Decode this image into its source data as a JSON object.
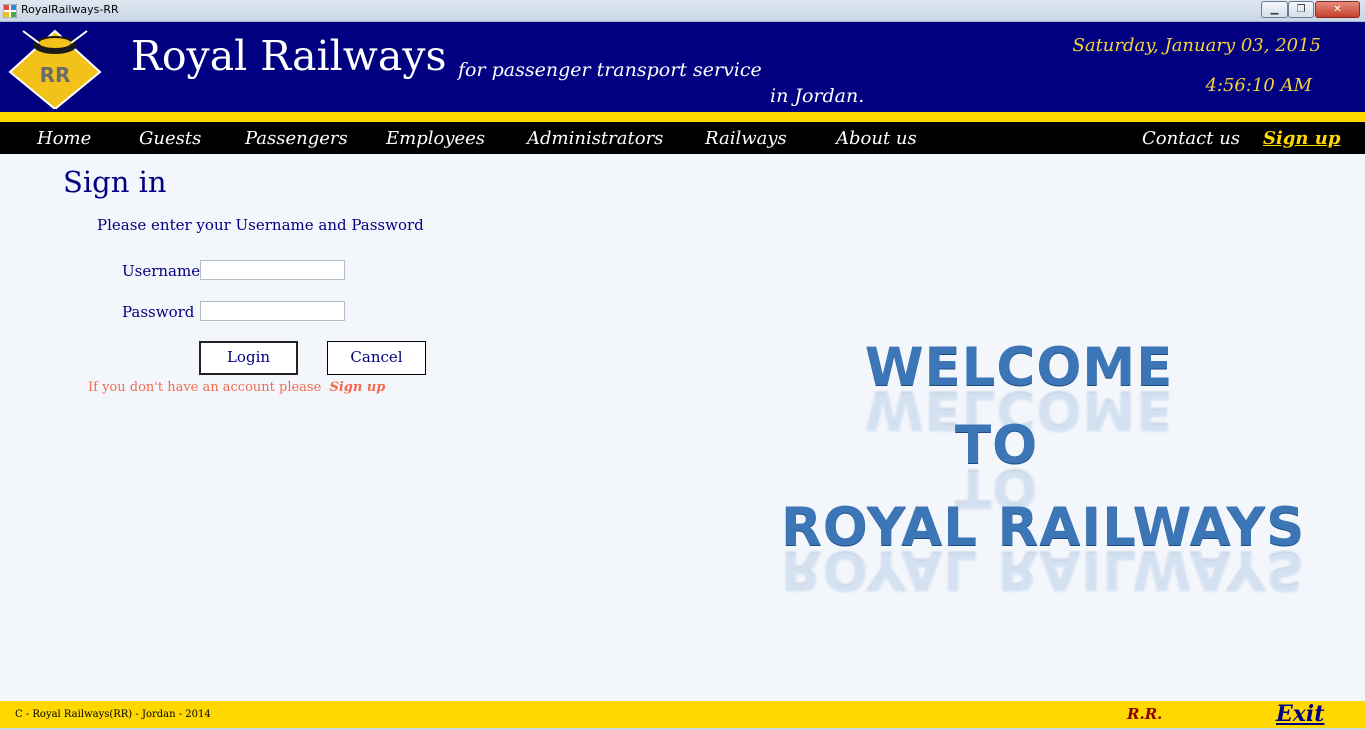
{
  "window": {
    "title": "RoyalRailways-RR",
    "min_glyph": "▁",
    "max_glyph": "❐",
    "close_glyph": "✕"
  },
  "header": {
    "logo_text": "RR",
    "brand": "Royal Railways",
    "tagline_line1": "for passenger transport service",
    "tagline_line2": "in Jordan.",
    "date": "Saturday, January 03, 2015",
    "time": "4:56:10 AM"
  },
  "nav": {
    "items": [
      "Home",
      "Guests",
      "Passengers",
      "Employees",
      "Administrators",
      "Railways",
      "About us"
    ],
    "contact": "Contact us",
    "signup": "Sign up"
  },
  "signin": {
    "title": "Sign in",
    "prompt": "Please enter your Username and Password",
    "username_label": "Username",
    "password_label": "Password",
    "username_value": "",
    "password_value": "",
    "login_label": "Login",
    "cancel_label": "Cancel",
    "no_account_text": "If you don't have an account please",
    "signup_link": "Sign up"
  },
  "welcome": {
    "line1": "WELCOME",
    "line2": "TO",
    "line3": "ROYAL RAILWAYS"
  },
  "footer": {
    "copyright": "C - Royal Railways(RR) - Jordan - 2014",
    "rr": "R.R.",
    "exit": "Exit"
  },
  "colors": {
    "header_bg": "#000080",
    "band_yellow": "#ffd800",
    "nav_bg": "#000000",
    "date_color": "#f7d33a",
    "link_orange": "#f26b4f"
  },
  "icons": {
    "app": "app-window-icon",
    "logo": "rr-logo-icon"
  }
}
